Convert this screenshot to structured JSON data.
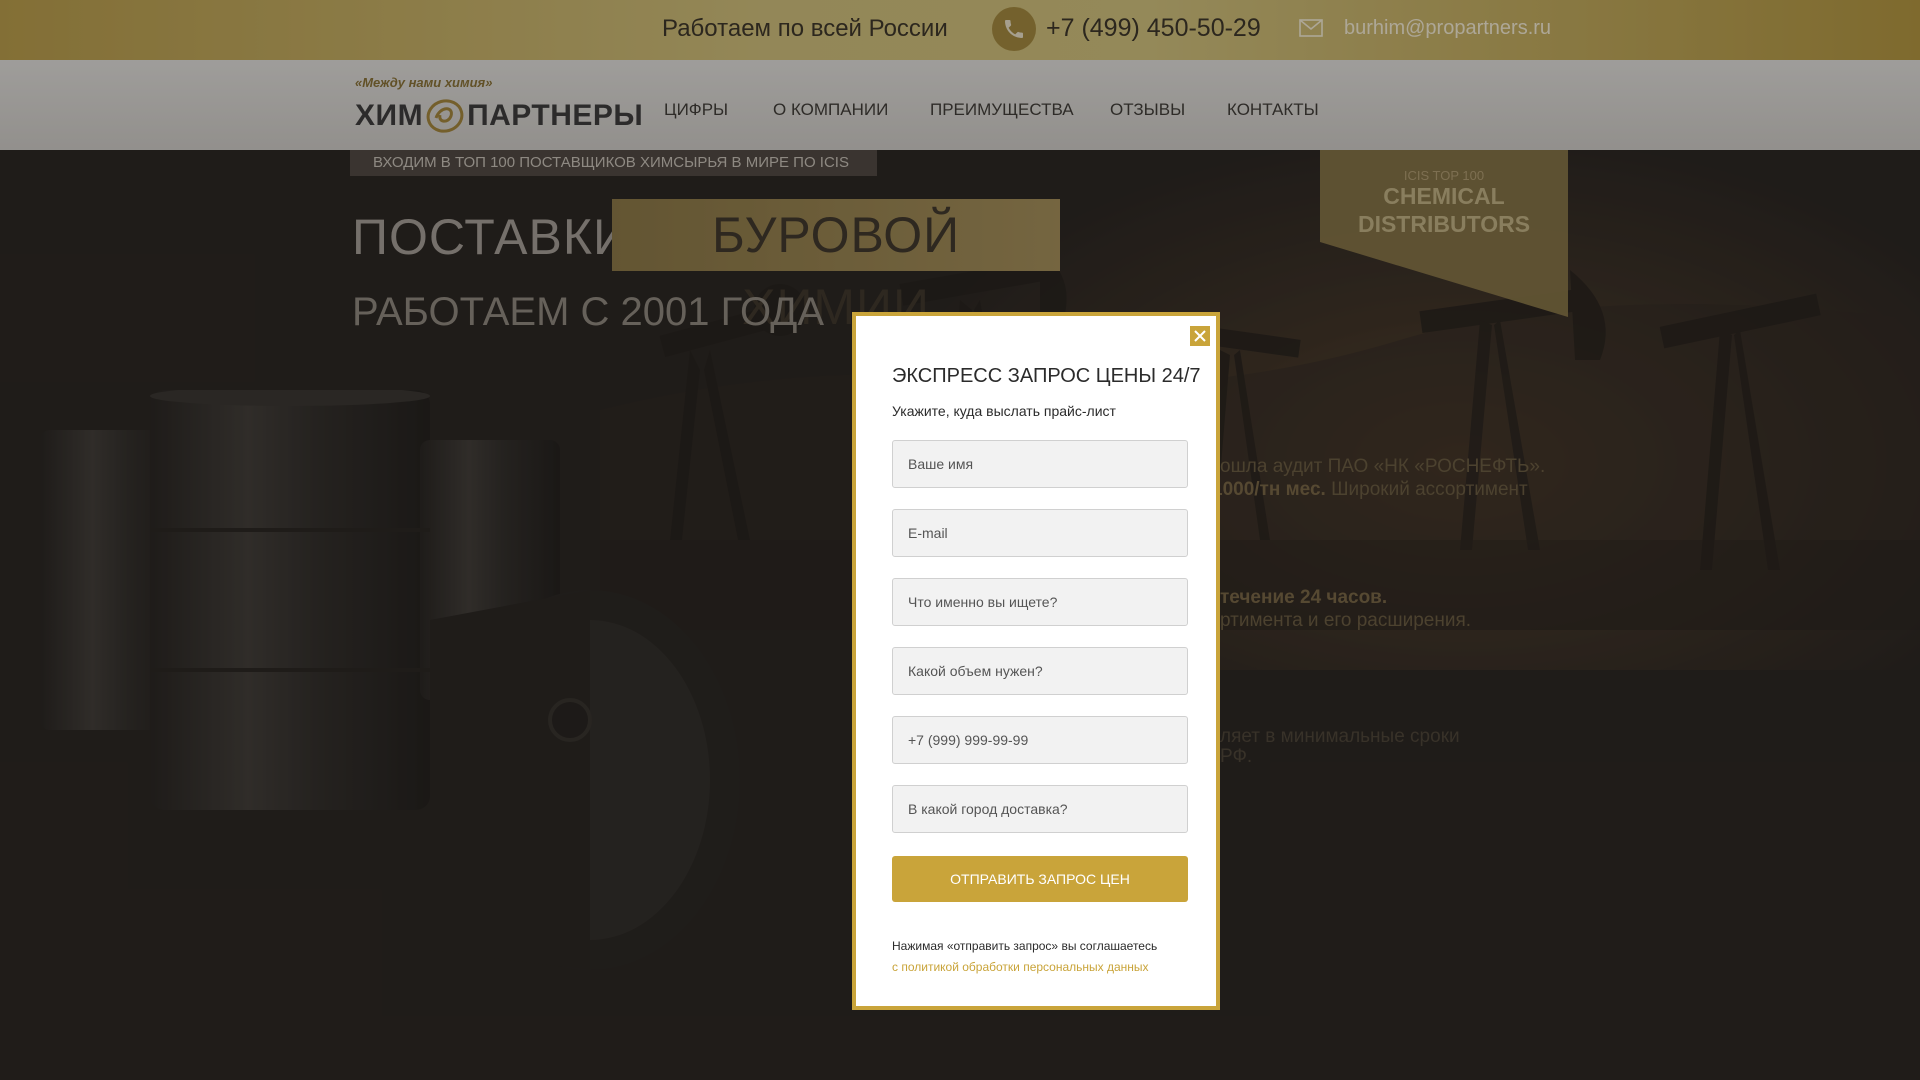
{
  "topbar": {
    "region": "Работаем по всей России",
    "phone": "+7 (499) 450-50-29",
    "email": "burhim@propartners.ru",
    "phone_icon": "phone-icon",
    "mail_icon": "mail-icon"
  },
  "logo": {
    "tagline": "«Между нами химия»",
    "left_word": "ХИМ",
    "right_word": "ПАРТНЕРЫ"
  },
  "nav": {
    "items": [
      {
        "label": "ЦИФРЫ"
      },
      {
        "label": "О КОМПАНИИ"
      },
      {
        "label": "ПРЕИМУЩЕСТВА"
      },
      {
        "label": "ОТЗЫВЫ"
      },
      {
        "label": "КОНТАКТЫ"
      }
    ]
  },
  "hero": {
    "banner": "ВХОДИМ В ТОП 100 ПОСТАВЩИКОВ ХИМСЫРЬЯ В МИРЕ ПО ICIS",
    "title_plain": "ПОСТАВКИ",
    "title_highlight": "БУРОВОЙ ХИМИИ",
    "subtitle": "РАБОТАЕМ С 2001 ГОДА",
    "ribbon_small": "ICIS TOP 100",
    "ribbon_line1": "CHEMICAL",
    "ribbon_line2": "DISTRIBUTORS",
    "bg_text": [
      {
        "plain": "ошла аудит ПАО «НК «РОСНЕФТЬ».",
        "bold": ""
      },
      {
        "bold": "1000/тн мес.",
        "plain": " Широкий ассортимент"
      },
      {
        "bold": " течение 24 часов.",
        "plain": ""
      },
      {
        "plain": "ртимента и его расширения.",
        "bold": ""
      },
      {
        "plain": "ляет в минимальные сроки",
        "bold": ""
      },
      {
        "plain": " РФ.",
        "bold": ""
      }
    ]
  },
  "modal": {
    "title": "ЭКСПРЕСС ЗАПРОС ЦЕНЫ 24/7",
    "subtitle": "Укажите, куда выслать прайс-лист",
    "fields": {
      "name": "Ваше имя",
      "email": "E-mail",
      "what": "Что именно вы ищете?",
      "volume": "Какой объем нужен?",
      "phone": "+7 (999) 999-99-99",
      "city": "В какой город доставка?"
    },
    "submit": "ОТПРАВИТЬ ЗАПРОС ЦЕН",
    "agree_text": "Нажимая «отправить запрос» вы соглашаетесь",
    "agree_link": "с политикой обработки персональных данных",
    "close_icon": "close-icon"
  },
  "colors": {
    "gold": "#c9a43a",
    "top_bar": "#d8c77e",
    "nav_bg": "#e3e2de",
    "hero_bg": "#2c2723"
  }
}
